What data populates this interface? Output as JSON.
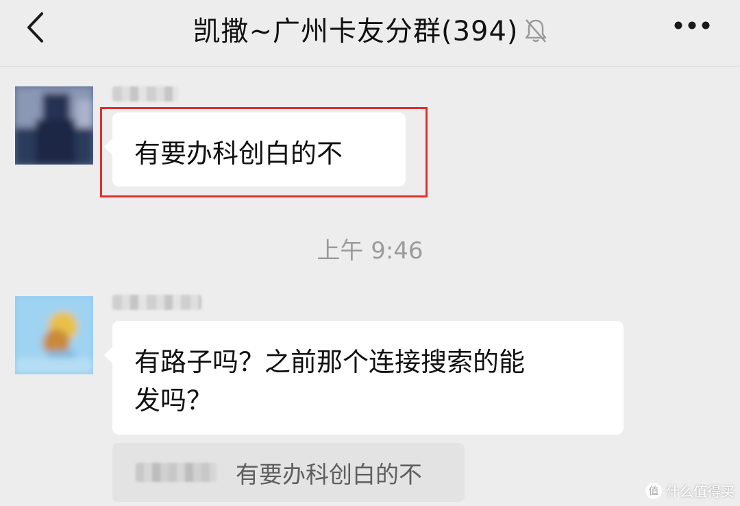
{
  "header": {
    "title": "凯撒~广州卡友分群(394)",
    "back_icon": "chevron-left-icon",
    "mute_icon": "bell-muted-icon",
    "more_icon": "more-horizontal-icon"
  },
  "messages": [
    {
      "text": "有要办科创白的不",
      "highlighted": true
    },
    {
      "text_line1": "有路子吗？之前那个连接搜索的能",
      "text_line2": "发吗？"
    }
  ],
  "timestamp": "上午 9:46",
  "quote": {
    "text": "有要办科创白的不"
  },
  "watermark": {
    "text": "什么值得买",
    "logo": "值"
  },
  "colors": {
    "background": "#ededed",
    "bubble": "#ffffff",
    "highlight": "#e0302e"
  }
}
